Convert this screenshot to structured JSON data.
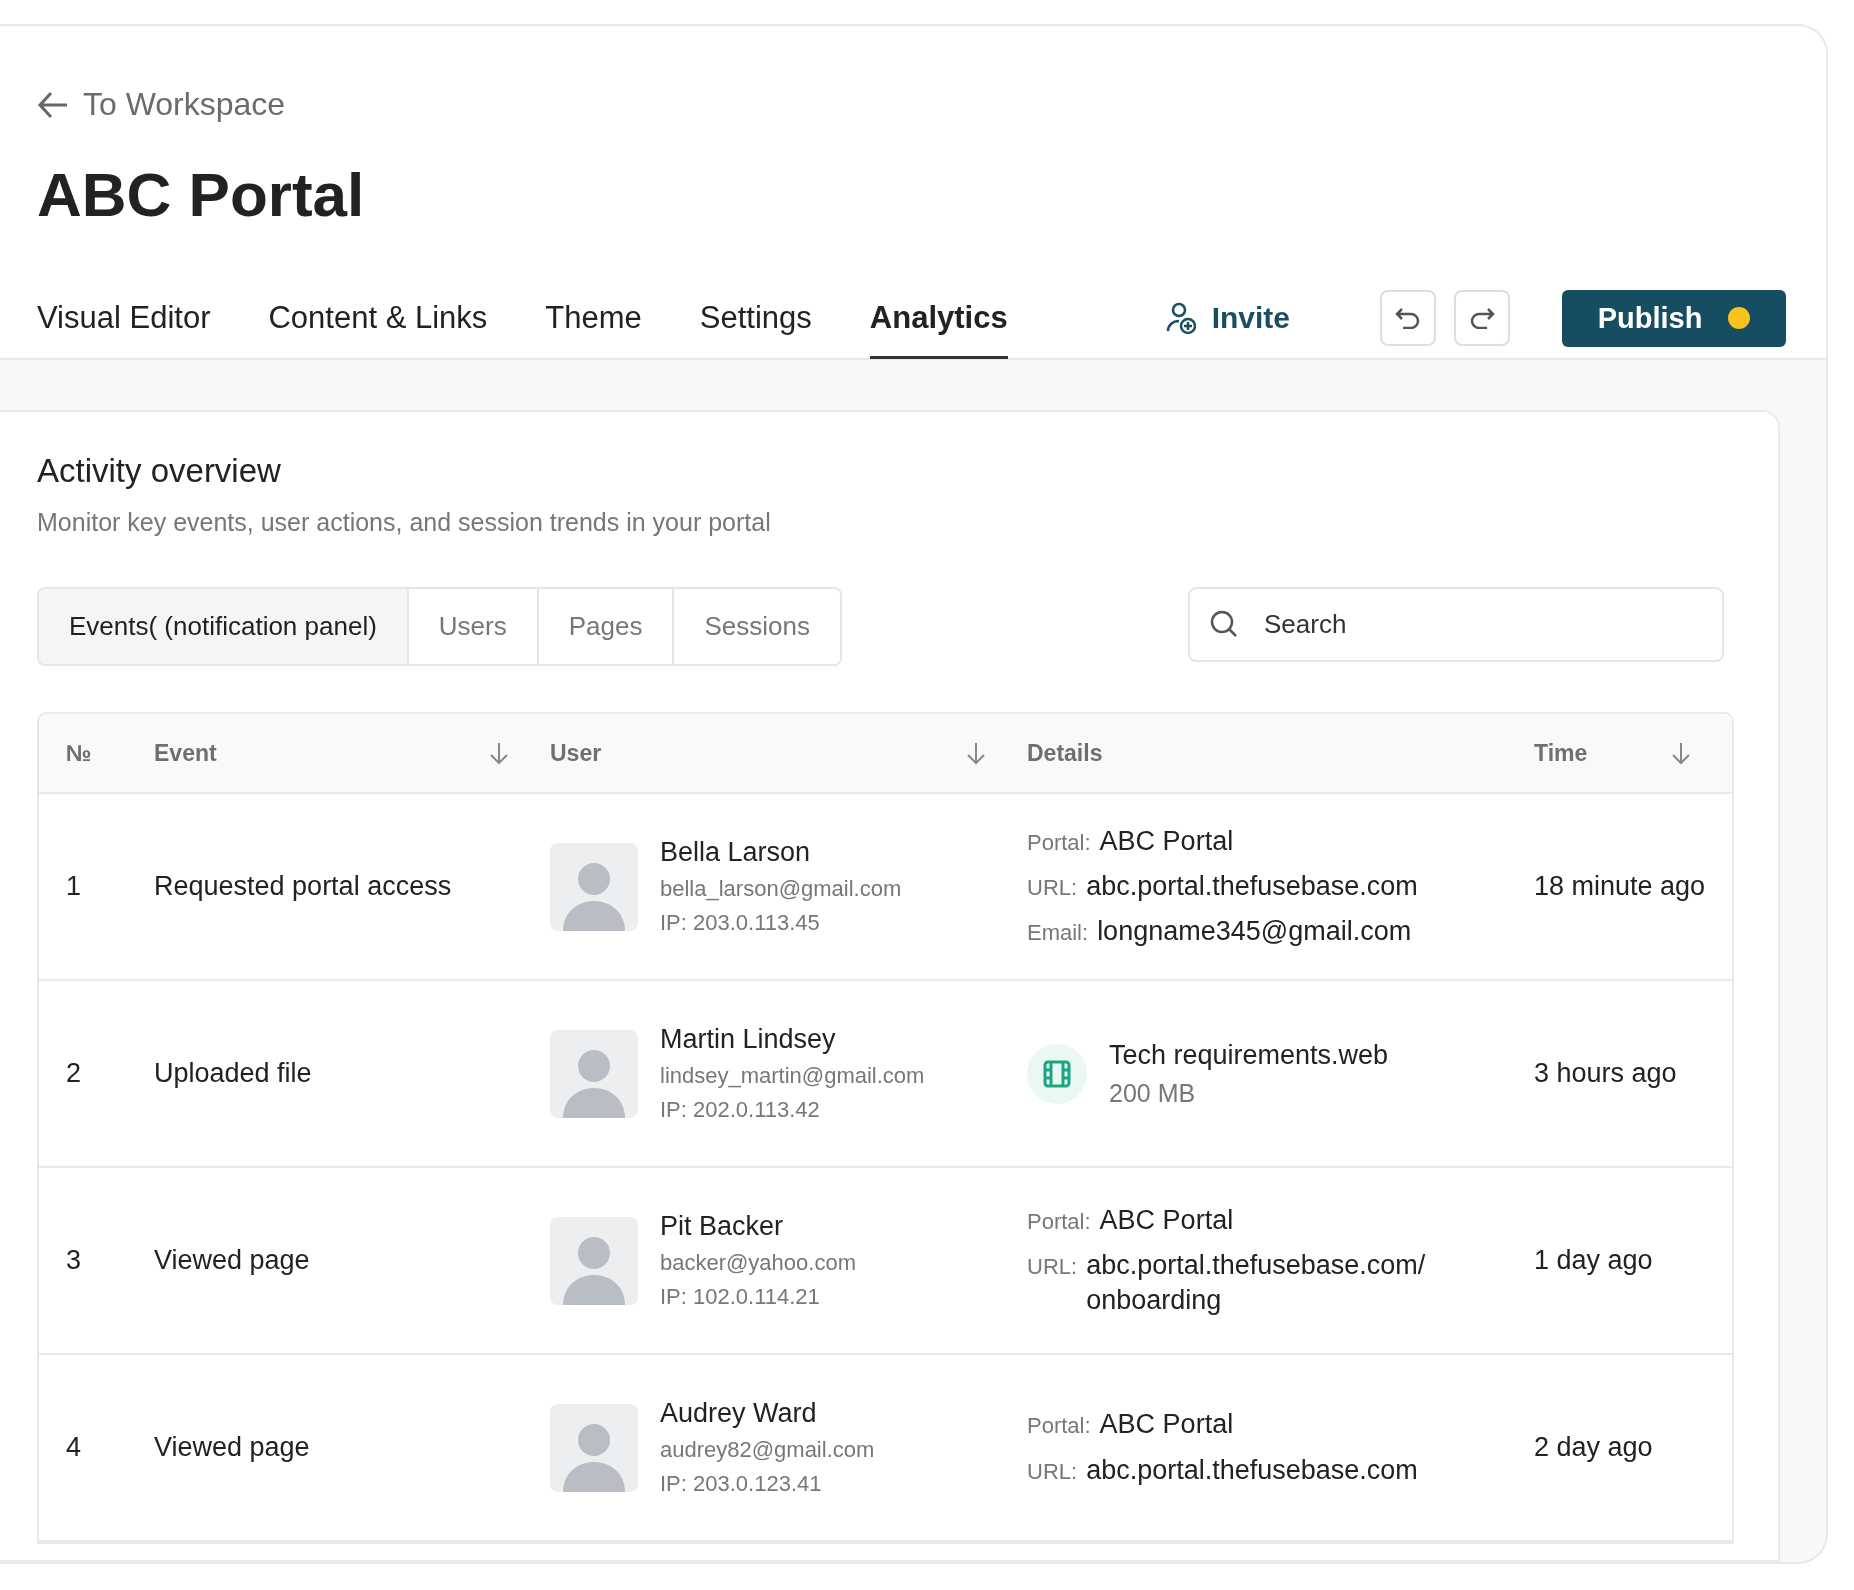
{
  "back_link": {
    "label": "To Workspace"
  },
  "title": "ABC Portal",
  "tabs": [
    {
      "label": "Visual Editor",
      "selected": false
    },
    {
      "label": "Content & Links",
      "selected": false
    },
    {
      "label": "Theme",
      "selected": false
    },
    {
      "label": "Settings",
      "selected": false
    },
    {
      "label": "Analytics",
      "selected": true
    }
  ],
  "invite_button": {
    "label": "Invite"
  },
  "publish_button": {
    "label": "Publish"
  },
  "section": {
    "title": "Activity overview",
    "subtitle": "Monitor key events, user actions, and session trends in your portal"
  },
  "filter_tabs": [
    {
      "label": "Events( (notification panel)",
      "selected": true
    },
    {
      "label": "Users",
      "selected": false
    },
    {
      "label": "Pages",
      "selected": false
    },
    {
      "label": "Sessions",
      "selected": false
    }
  ],
  "search": {
    "placeholder": "Search"
  },
  "table": {
    "columns": [
      {
        "label": "№",
        "sortable": false
      },
      {
        "label": "Event",
        "sortable": true
      },
      {
        "label": "User",
        "sortable": true
      },
      {
        "label": "Details",
        "sortable": false
      },
      {
        "label": "Time",
        "sortable": true
      }
    ],
    "rows": [
      {
        "number": "1",
        "event": "Requested portal access",
        "user": {
          "name": "Bella Larson",
          "email": "bella_larson@gmail.com",
          "ip": "IP: 203.0.113.45"
        },
        "details": {
          "kind": "fields",
          "fields": [
            {
              "label": "Portal:",
              "value": "ABC Portal"
            },
            {
              "label": "URL:",
              "value": "abc.portal.thefusebase.com"
            },
            {
              "label": "Email:",
              "value": "longname345@gmail.com"
            }
          ]
        },
        "time": "18 minute ago"
      },
      {
        "number": "2",
        "event": "Uploaded file",
        "user": {
          "name": "Martin Lindsey",
          "email": "lindsey_martin@gmail.com",
          "ip": "IP: 202.0.113.42"
        },
        "details": {
          "kind": "file",
          "file_name": "Tech requirements.web",
          "file_size": "200 MB"
        },
        "time": "3 hours ago"
      },
      {
        "number": "3",
        "event": "Viewed page",
        "user": {
          "name": "Pit Backer",
          "email": "backer@yahoo.com",
          "ip": "IP: 102.0.114.21"
        },
        "details": {
          "kind": "fields",
          "fields": [
            {
              "label": "Portal:",
              "value": "ABC Portal"
            },
            {
              "label": "URL:",
              "value": "abc.portal.thefusebase.com/\nonboarding"
            }
          ]
        },
        "time": "1 day ago"
      },
      {
        "number": "4",
        "event": "Viewed page",
        "user": {
          "name": "Audrey Ward",
          "email": "audrey82@gmail.com",
          "ip": "IP: 203.0.123.41"
        },
        "details": {
          "kind": "fields",
          "fields": [
            {
              "label": "Portal:",
              "value": "ABC Portal"
            },
            {
              "label": "URL:",
              "value": "abc.portal.thefusebase.com"
            }
          ]
        },
        "time": "2 day ago"
      }
    ]
  }
}
